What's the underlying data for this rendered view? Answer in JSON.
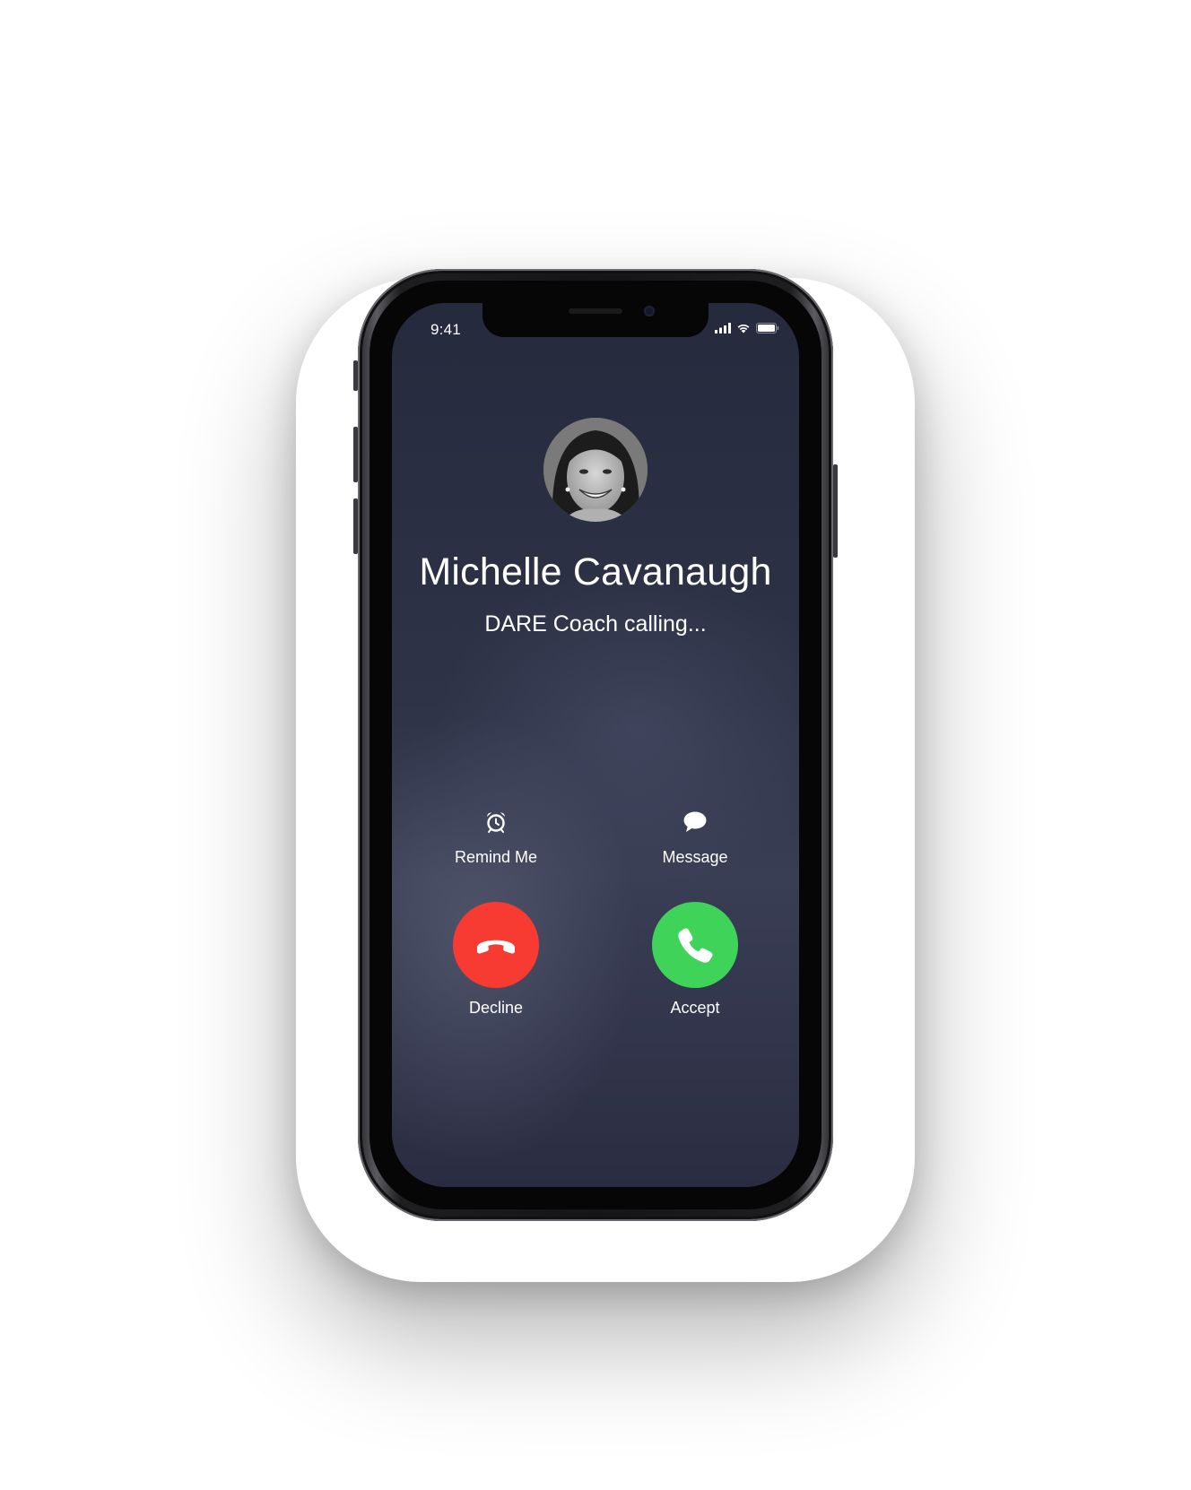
{
  "status_bar": {
    "time": "9:41",
    "icons": [
      "cellular-signal-icon",
      "wifi-icon",
      "battery-icon"
    ]
  },
  "caller": {
    "name": "Michelle Cavanaugh",
    "status": "DARE Coach calling..."
  },
  "actions": {
    "remind": {
      "label": "Remind Me",
      "icon": "alarm-clock-icon"
    },
    "message": {
      "label": "Message",
      "icon": "speech-bubble-icon"
    }
  },
  "call_buttons": {
    "decline": {
      "label": "Decline",
      "icon": "phone-hangup-icon",
      "color": "#f73a32"
    },
    "accept": {
      "label": "Accept",
      "icon": "phone-icon",
      "color": "#3fd35a"
    }
  },
  "colors": {
    "screen_background": "#2f3348",
    "text": "#ffffff"
  }
}
